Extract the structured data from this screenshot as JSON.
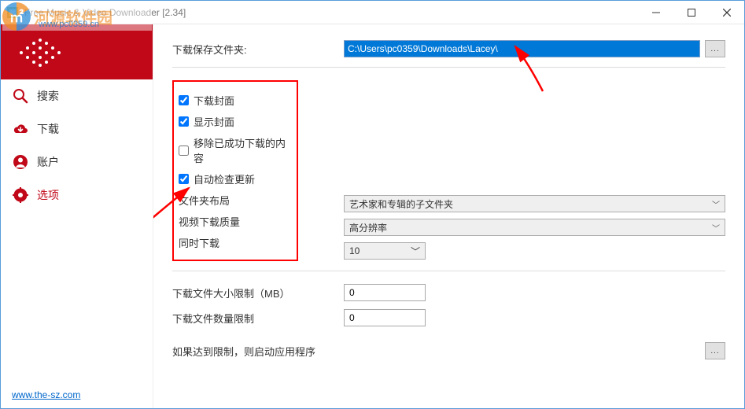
{
  "window": {
    "title": "Free Music & Video Downloader [2.34]"
  },
  "watermark": {
    "brand_text": "河源软件园",
    "url": "www.pc0359.cn"
  },
  "sidebar": {
    "items": [
      {
        "label": "搜索",
        "icon": "search"
      },
      {
        "label": "下载",
        "icon": "cloud-download"
      },
      {
        "label": "账户",
        "icon": "user"
      },
      {
        "label": "选项",
        "icon": "gear"
      }
    ],
    "footer_link": "www.the-sz.com"
  },
  "options": {
    "save_folder_label": "下载保存文件夹:",
    "save_folder_path": "C:\\Users\\pc0359\\Downloads\\Lacey\\",
    "browse_btn": "...",
    "download_cover_label": "下载封面",
    "download_cover_checked": true,
    "show_cover_label": "显示封面",
    "show_cover_checked": true,
    "remove_after_label": "移除已成功下载的内容",
    "remove_after_checked": false,
    "auto_update_label": "自动检查更新",
    "auto_update_checked": true,
    "folder_layout_label": "文件夹布局",
    "folder_layout_value": "艺术家和专辑的子文件夹",
    "video_quality_label": "视频下载质量",
    "video_quality_value": "高分辨率",
    "concurrent_label": "同时下载",
    "concurrent_value": "10",
    "size_limit_label": "下载文件大小限制（MB）",
    "size_limit_value": "0",
    "count_limit_label": "下载文件数量限制",
    "count_limit_value": "0",
    "on_limit_app_label": "如果达到限制，则启动应用程序",
    "on_limit_browse": "..."
  }
}
